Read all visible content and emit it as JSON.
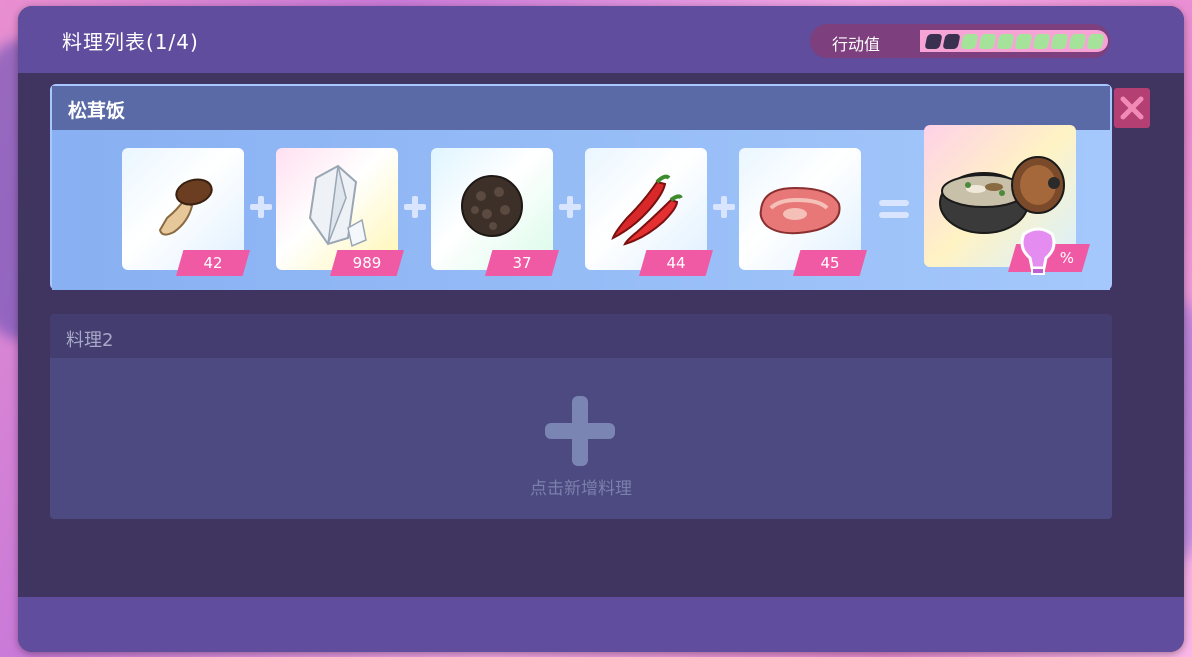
{
  "header": {
    "title": "料理列表(1/4)",
    "stamina_label": "行动值",
    "stamina_total": 10,
    "stamina_filled": 8
  },
  "recipe1": {
    "name": "松茸饭",
    "ingredients": [
      {
        "icon": "mushroom-icon",
        "count": "42"
      },
      {
        "icon": "crystal-icon",
        "count": "989"
      },
      {
        "icon": "truffle-icon",
        "count": "37"
      },
      {
        "icon": "chili-pepper-icon",
        "count": "44"
      },
      {
        "icon": "meat-icon",
        "count": "45"
      }
    ],
    "result": {
      "icon": "rice-pot-icon",
      "badge_text": "%"
    }
  },
  "recipe2": {
    "title": "料理2",
    "add_label": "点击新增料理"
  },
  "colors": {
    "accent_pink": "#f05aa5",
    "header_purple": "#614d9d",
    "stamina_green": "#a6e39a"
  }
}
